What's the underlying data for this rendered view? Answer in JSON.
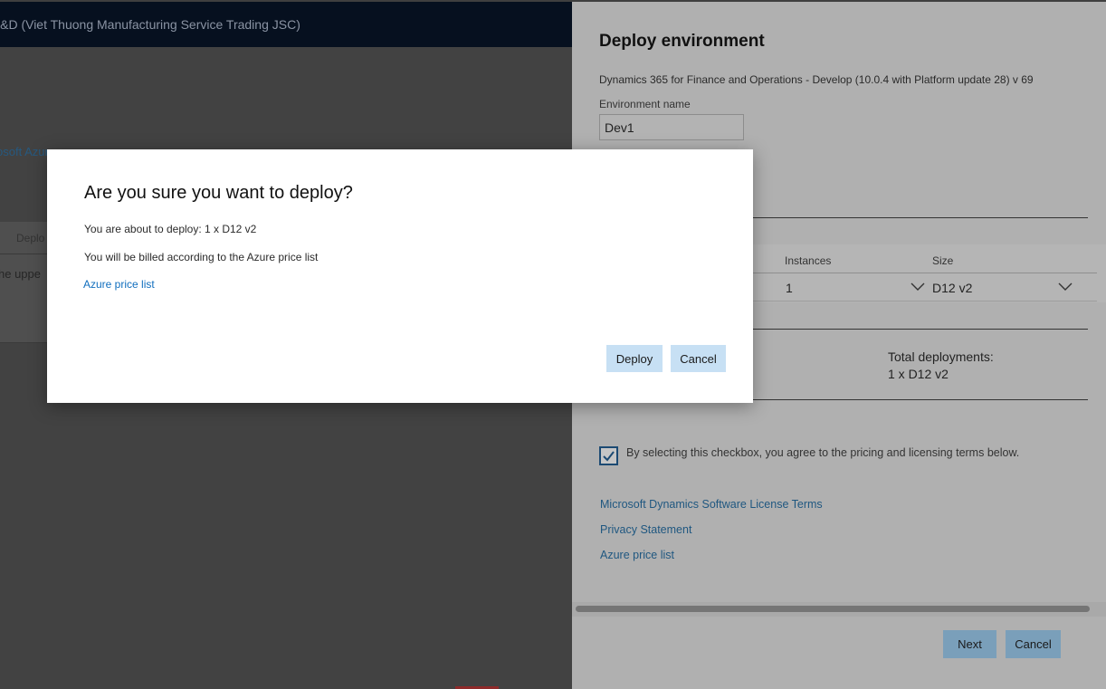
{
  "background": {
    "org_title": "R&D (Viet Thuong Manufacturing Service Trading JSC)",
    "link_fragment": "osoft Azure",
    "tab_fragment": "Deplo",
    "text_fragment": "he uppe"
  },
  "panel": {
    "title": "Deploy environment",
    "subtitle": "Dynamics 365 for Finance and Operations - Develop (10.0.4 with Platform update 28) v 69",
    "env_name_label": "Environment name",
    "env_name_value": "Dev1",
    "columns": {
      "instances": "Instances",
      "size": "Size"
    },
    "instances_value": "1",
    "size_value": "D12 v2",
    "total_label": "Total deployments:",
    "total_value": "1 x D12 v2",
    "agree_checked": true,
    "agree_text": "By selecting this checkbox, you agree to the pricing and licensing terms below.",
    "links": {
      "license": "Microsoft Dynamics Software License Terms",
      "privacy": "Privacy Statement",
      "azure_price": "Azure price list"
    },
    "buttons": {
      "next": "Next",
      "cancel": "Cancel"
    }
  },
  "dialog": {
    "title": "Are you sure you want to deploy?",
    "line1": "You are about to deploy: 1 x D12 v2",
    "line2": "You will be billed according to the Azure price list",
    "link": "Azure price list",
    "buttons": {
      "deploy": "Deploy",
      "cancel": "Cancel"
    }
  },
  "colors": {
    "accent_link": "#106ebe",
    "dialog_button": "#c7e0f4",
    "topbar": "#06101f"
  },
  "icons": [
    "chevron-down-icon",
    "checkmark-icon"
  ]
}
